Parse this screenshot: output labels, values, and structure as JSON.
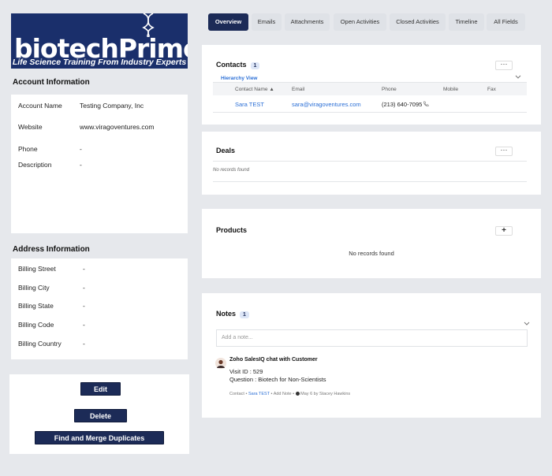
{
  "logo": {
    "main": "biotechPrimer",
    "tagline": "Life Science Training From Industry Experts"
  },
  "account_info": {
    "title": "Account Information",
    "rows": [
      {
        "label": "Account Name",
        "value": "Testing Company, Inc"
      },
      {
        "label": "Website",
        "value": "www.viragoventures.com"
      },
      {
        "label": "Phone",
        "value": "-"
      },
      {
        "label": "Description",
        "value": "-"
      }
    ]
  },
  "address_info": {
    "title": "Address Information",
    "rows": [
      {
        "label": "Billing Street",
        "value": "-"
      },
      {
        "label": "Billing City",
        "value": "-"
      },
      {
        "label": "Billing State",
        "value": "-"
      },
      {
        "label": "Billing Code",
        "value": "-"
      },
      {
        "label": "Billing Country",
        "value": "-"
      }
    ]
  },
  "actions": {
    "edit": "Edit",
    "delete": "Delete",
    "merge": "Find and Merge Duplicates"
  },
  "tabs": [
    "Overview",
    "Emails",
    "Attachments",
    "Open Activities",
    "Closed Activities",
    "Timeline",
    "All Fields"
  ],
  "contacts": {
    "title": "Contacts",
    "count": "1",
    "more": "···",
    "hierarchy_link": "Hierarchy View",
    "columns": [
      "Contact Name",
      "Email",
      "Phone",
      "Mobile",
      "Fax"
    ],
    "rows": [
      {
        "name": "Sara TEST",
        "email": "sara@viragoventures.com",
        "phone": "(213) 640-7095"
      }
    ]
  },
  "deals": {
    "title": "Deals",
    "more": "···",
    "empty": "No records found"
  },
  "products": {
    "title": "Products",
    "add": "+",
    "empty": "No records found"
  },
  "notes": {
    "title": "Notes",
    "count": "1",
    "placeholder": "Add a note...",
    "item": {
      "title": "Zoho SalesIQ chat with Customer",
      "line1": "Visit ID : 529",
      "line2": "Question : Biotech for Non-Scientists",
      "meta_contact": "Contact",
      "meta_sep": "•",
      "meta_name": "Sara TEST",
      "meta_add": "Add Note",
      "meta_date": "May 6",
      "meta_by": "by Stacey Hawkins"
    }
  },
  "colors": {
    "navy": "#1c2b57",
    "link": "#2b6fd6",
    "logo_bg": "#1a2f6b"
  }
}
